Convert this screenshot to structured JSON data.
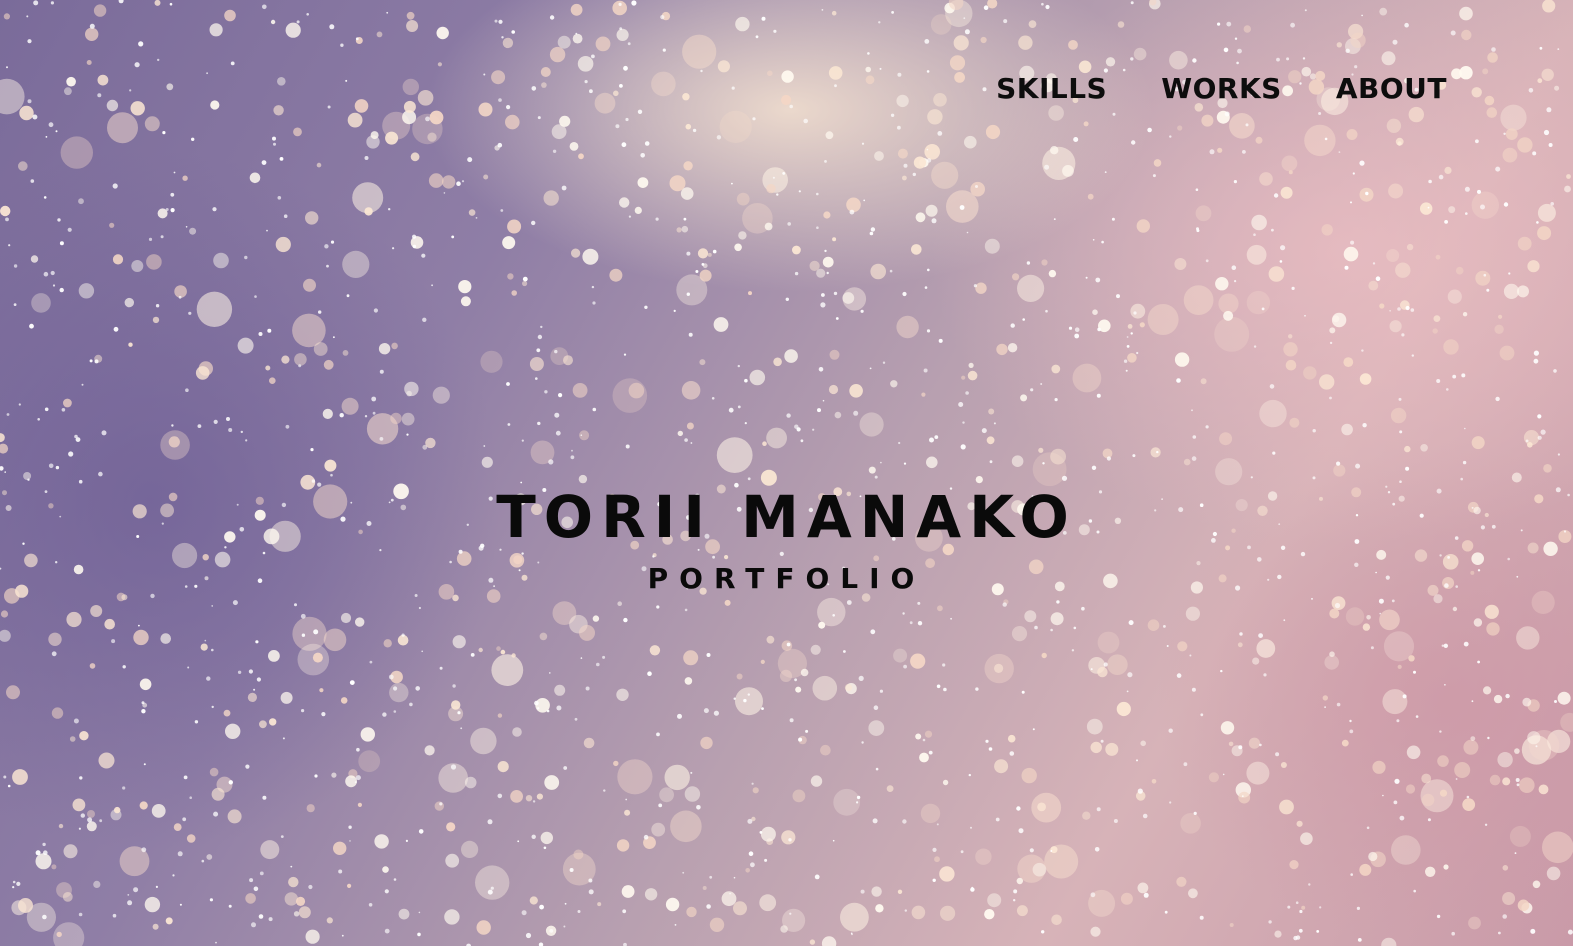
{
  "nav": {
    "items": [
      {
        "label": "SKILLS"
      },
      {
        "label": "WORKS"
      },
      {
        "label": "ABOUT"
      }
    ]
  },
  "hero": {
    "title": "TORII MANAKO",
    "subtitle": "PORTFOLIO",
    "background": "bokeh-snow-photo"
  },
  "colors": {
    "text": "#0a0a0a",
    "bg_purple": "#7a6b9a",
    "bg_pink": "#d7b3b8",
    "bg_cream": "#f8e6d2"
  }
}
